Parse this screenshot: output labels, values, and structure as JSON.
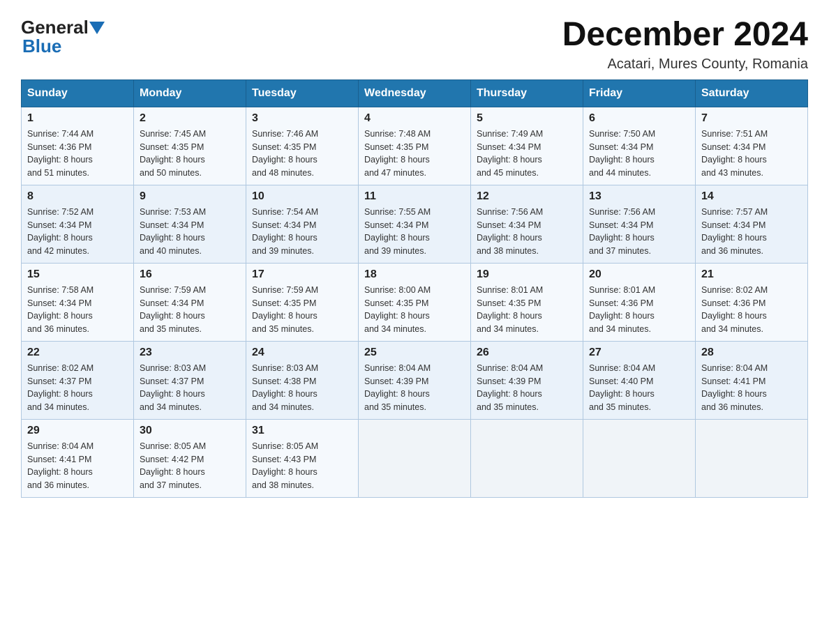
{
  "header": {
    "logo_general": "General",
    "logo_blue": "Blue",
    "title": "December 2024",
    "location": "Acatari, Mures County, Romania"
  },
  "days_of_week": [
    "Sunday",
    "Monday",
    "Tuesday",
    "Wednesday",
    "Thursday",
    "Friday",
    "Saturday"
  ],
  "weeks": [
    [
      {
        "day": "1",
        "sunrise": "7:44 AM",
        "sunset": "4:36 PM",
        "daylight": "8 hours and 51 minutes."
      },
      {
        "day": "2",
        "sunrise": "7:45 AM",
        "sunset": "4:35 PM",
        "daylight": "8 hours and 50 minutes."
      },
      {
        "day": "3",
        "sunrise": "7:46 AM",
        "sunset": "4:35 PM",
        "daylight": "8 hours and 48 minutes."
      },
      {
        "day": "4",
        "sunrise": "7:48 AM",
        "sunset": "4:35 PM",
        "daylight": "8 hours and 47 minutes."
      },
      {
        "day": "5",
        "sunrise": "7:49 AM",
        "sunset": "4:34 PM",
        "daylight": "8 hours and 45 minutes."
      },
      {
        "day": "6",
        "sunrise": "7:50 AM",
        "sunset": "4:34 PM",
        "daylight": "8 hours and 44 minutes."
      },
      {
        "day": "7",
        "sunrise": "7:51 AM",
        "sunset": "4:34 PM",
        "daylight": "8 hours and 43 minutes."
      }
    ],
    [
      {
        "day": "8",
        "sunrise": "7:52 AM",
        "sunset": "4:34 PM",
        "daylight": "8 hours and 42 minutes."
      },
      {
        "day": "9",
        "sunrise": "7:53 AM",
        "sunset": "4:34 PM",
        "daylight": "8 hours and 40 minutes."
      },
      {
        "day": "10",
        "sunrise": "7:54 AM",
        "sunset": "4:34 PM",
        "daylight": "8 hours and 39 minutes."
      },
      {
        "day": "11",
        "sunrise": "7:55 AM",
        "sunset": "4:34 PM",
        "daylight": "8 hours and 39 minutes."
      },
      {
        "day": "12",
        "sunrise": "7:56 AM",
        "sunset": "4:34 PM",
        "daylight": "8 hours and 38 minutes."
      },
      {
        "day": "13",
        "sunrise": "7:56 AM",
        "sunset": "4:34 PM",
        "daylight": "8 hours and 37 minutes."
      },
      {
        "day": "14",
        "sunrise": "7:57 AM",
        "sunset": "4:34 PM",
        "daylight": "8 hours and 36 minutes."
      }
    ],
    [
      {
        "day": "15",
        "sunrise": "7:58 AM",
        "sunset": "4:34 PM",
        "daylight": "8 hours and 36 minutes."
      },
      {
        "day": "16",
        "sunrise": "7:59 AM",
        "sunset": "4:34 PM",
        "daylight": "8 hours and 35 minutes."
      },
      {
        "day": "17",
        "sunrise": "7:59 AM",
        "sunset": "4:35 PM",
        "daylight": "8 hours and 35 minutes."
      },
      {
        "day": "18",
        "sunrise": "8:00 AM",
        "sunset": "4:35 PM",
        "daylight": "8 hours and 34 minutes."
      },
      {
        "day": "19",
        "sunrise": "8:01 AM",
        "sunset": "4:35 PM",
        "daylight": "8 hours and 34 minutes."
      },
      {
        "day": "20",
        "sunrise": "8:01 AM",
        "sunset": "4:36 PM",
        "daylight": "8 hours and 34 minutes."
      },
      {
        "day": "21",
        "sunrise": "8:02 AM",
        "sunset": "4:36 PM",
        "daylight": "8 hours and 34 minutes."
      }
    ],
    [
      {
        "day": "22",
        "sunrise": "8:02 AM",
        "sunset": "4:37 PM",
        "daylight": "8 hours and 34 minutes."
      },
      {
        "day": "23",
        "sunrise": "8:03 AM",
        "sunset": "4:37 PM",
        "daylight": "8 hours and 34 minutes."
      },
      {
        "day": "24",
        "sunrise": "8:03 AM",
        "sunset": "4:38 PM",
        "daylight": "8 hours and 34 minutes."
      },
      {
        "day": "25",
        "sunrise": "8:04 AM",
        "sunset": "4:39 PM",
        "daylight": "8 hours and 35 minutes."
      },
      {
        "day": "26",
        "sunrise": "8:04 AM",
        "sunset": "4:39 PM",
        "daylight": "8 hours and 35 minutes."
      },
      {
        "day": "27",
        "sunrise": "8:04 AM",
        "sunset": "4:40 PM",
        "daylight": "8 hours and 35 minutes."
      },
      {
        "day": "28",
        "sunrise": "8:04 AM",
        "sunset": "4:41 PM",
        "daylight": "8 hours and 36 minutes."
      }
    ],
    [
      {
        "day": "29",
        "sunrise": "8:04 AM",
        "sunset": "4:41 PM",
        "daylight": "8 hours and 36 minutes."
      },
      {
        "day": "30",
        "sunrise": "8:05 AM",
        "sunset": "4:42 PM",
        "daylight": "8 hours and 37 minutes."
      },
      {
        "day": "31",
        "sunrise": "8:05 AM",
        "sunset": "4:43 PM",
        "daylight": "8 hours and 38 minutes."
      },
      null,
      null,
      null,
      null
    ]
  ],
  "labels": {
    "sunrise": "Sunrise:",
    "sunset": "Sunset:",
    "daylight": "Daylight:"
  }
}
